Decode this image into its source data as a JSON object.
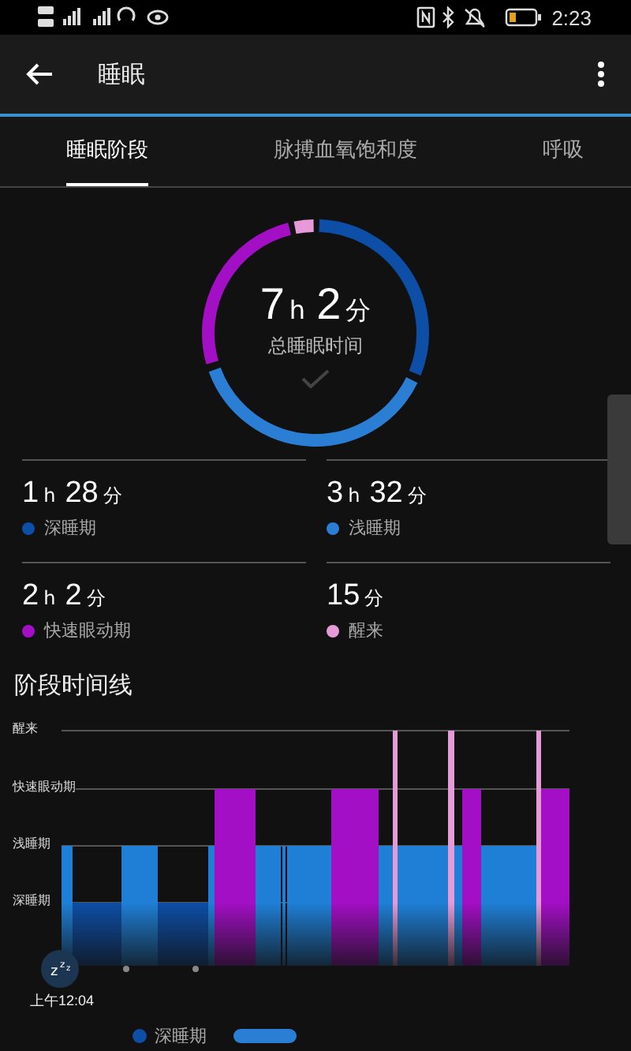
{
  "status_bar": {
    "time": "2:23"
  },
  "app_bar": {
    "title": "睡眠"
  },
  "tabs": [
    {
      "label": "睡眠阶段",
      "selected": true
    },
    {
      "label": "脉搏血氧饱和度",
      "selected": false
    },
    {
      "label": "呼吸",
      "selected": false
    }
  ],
  "summary": {
    "hours": "7",
    "hours_unit": "h",
    "minutes": "2",
    "minutes_unit": "分",
    "label": "总睡眠时间"
  },
  "stats": [
    {
      "parts": [
        {
          "num": "1",
          "unit": "h"
        },
        {
          "num": "28",
          "unit": "分"
        }
      ],
      "label": "深睡期",
      "color": "#0d4ea6"
    },
    {
      "parts": [
        {
          "num": "3",
          "unit": "h"
        },
        {
          "num": "32",
          "unit": "分"
        }
      ],
      "label": "浅睡期",
      "color": "#2a7fd4"
    },
    {
      "parts": [
        {
          "num": "2",
          "unit": "h"
        },
        {
          "num": "2",
          "unit": "分"
        }
      ],
      "label": "快速眼动期",
      "color": "#a20fc4"
    },
    {
      "parts": [
        {
          "num": "15",
          "unit": "分"
        }
      ],
      "label": "醒来",
      "color": "#e79ad8"
    }
  ],
  "timeline": {
    "title": "阶段时间线",
    "levels": [
      "醒来",
      "快速眼动期",
      "浅睡期",
      "深睡期"
    ],
    "start_time": "上午12:04",
    "start_marker": [
      "z",
      "z",
      "z"
    ]
  },
  "legend": [
    {
      "label": "深睡期",
      "color": "#0d4ea6"
    }
  ]
}
